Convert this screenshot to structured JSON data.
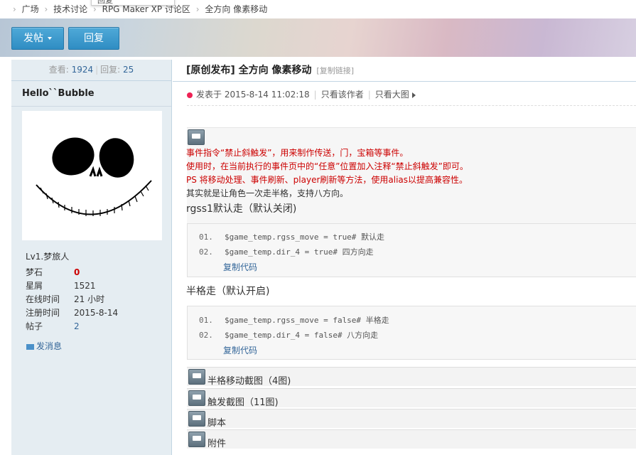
{
  "breadcrumb": {
    "home": "广场",
    "forum": "技术讨论",
    "subforum": "RPG Maker XP 讨论区",
    "current": "全方向 像素移动",
    "popup": "回复"
  },
  "toolbar": {
    "post_label": "发帖",
    "reply_label": "回复"
  },
  "sidebar": {
    "views_label": "查看:",
    "views": "1924",
    "replies_label": "回复:",
    "replies": "25",
    "username": "Hello``Bubble",
    "level": "Lv1.梦旅人",
    "stats": [
      {
        "key": "梦石",
        "value": "0"
      },
      {
        "key": "星屑",
        "value": "1521"
      },
      {
        "key": "在线时间",
        "value": "21 小时"
      },
      {
        "key": "注册时间",
        "value": "2015-8-14"
      },
      {
        "key": "帖子",
        "value": "2"
      }
    ],
    "message_label": "发消息",
    "colors": {
      "gem": "#cc0000",
      "link": "#336699"
    }
  },
  "post": {
    "title": "[原创发布] 全方向 像素移动",
    "copy_link": "[复制链接]",
    "posted_at": "发表于 2015-8-14 11:02:18",
    "only_author": "只看该作者",
    "only_big_image": "只看大图",
    "red_lines": [
      "事件指令“禁止斜触发”，用来制作传送，门，宝箱等事件。",
      "使用时，在当前执行的事件页中的“任意”位置加入注释“禁止斜触发”即可。",
      "PS 将移动处理、事件刷新、player刷新等方法，使用alias以提高兼容性。"
    ],
    "plain_line": "其实就是让角色一次走半格，支持八方向。",
    "section1": "rgss1默认走（默认关闭)",
    "code1": [
      {
        "ln": "01.",
        "text": "$game_temp.rgss_move = true# 默认走"
      },
      {
        "ln": "02.",
        "text": "$game_temp.dir_4 = true# 四方向走"
      }
    ],
    "copy_code1": "复制代码",
    "section2": "半格走（默认开启)",
    "code2": [
      {
        "ln": "01.",
        "text": "$game_temp.rgss_move = false# 半格走"
      },
      {
        "ln": "02.",
        "text": "$game_temp.dir_4 = false# 八方向走"
      }
    ],
    "copy_code2": "复制代码",
    "spoilers": [
      "半格移动截图（4图)",
      "触发截图（11图)",
      "脚本",
      "附件"
    ]
  }
}
